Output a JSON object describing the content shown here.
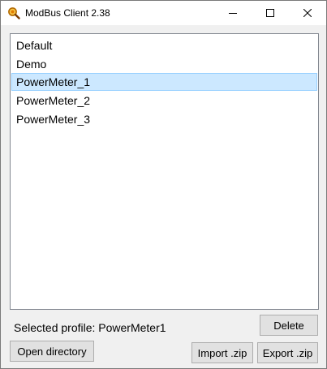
{
  "window": {
    "title": "ModBus Client 2.38"
  },
  "titlebar_icons": [
    "app-icon",
    "minimize-icon",
    "maximize-icon",
    "close-icon"
  ],
  "profiles": {
    "items": [
      {
        "label": "Default",
        "selected": false
      },
      {
        "label": "Demo",
        "selected": false
      },
      {
        "label": "PowerMeter_1",
        "selected": true
      },
      {
        "label": "PowerMeter_2",
        "selected": false
      },
      {
        "label": "PowerMeter_3",
        "selected": false
      }
    ]
  },
  "status": {
    "selected_profile_text": "Selected profile: PowerMeter1"
  },
  "buttons": {
    "delete": "Delete",
    "open_directory": "Open directory",
    "import_zip": "Import .zip",
    "export_zip": "Export .zip"
  },
  "colors": {
    "selection_bg": "#cce8ff",
    "selection_border": "#99d1ff",
    "button_bg": "#e1e1e1"
  }
}
